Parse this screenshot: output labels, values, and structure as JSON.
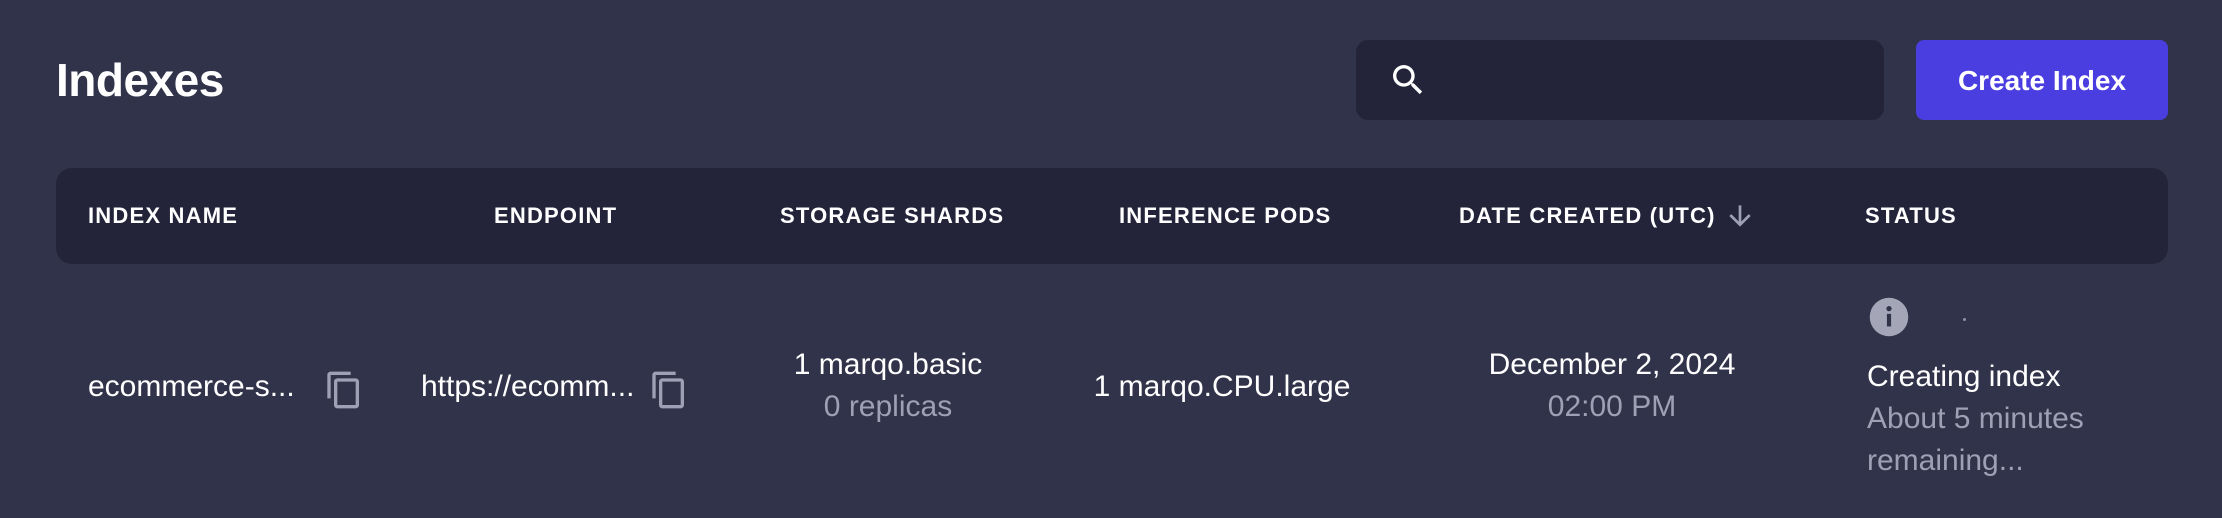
{
  "header": {
    "title": "Indexes",
    "create_button_label": "Create Index",
    "search": {
      "placeholder": "",
      "value": ""
    }
  },
  "table": {
    "columns": [
      "INDEX NAME",
      "ENDPOINT",
      "STORAGE SHARDS",
      "INFERENCE PODS",
      "DATE CREATED (UTC)",
      "STATUS"
    ],
    "sort": {
      "column": "DATE CREATED (UTC)",
      "direction": "descending"
    },
    "rows": [
      {
        "index_name": "ecommerce-s...",
        "endpoint": "https://ecomm...",
        "storage_shards": "1 marqo.basic",
        "replicas": "0 replicas",
        "inference_pods": "1 marqo.CPU.large",
        "date": "December 2, 2024",
        "time": "02:00 PM",
        "status": "Creating index",
        "status_detail_line1": "About 5 minutes",
        "status_detail_line2": "remaining..."
      }
    ]
  },
  "icons": {
    "search": "search-icon",
    "sort": "arrow-down-icon",
    "copy": "copy-icon",
    "info": "info-icon"
  },
  "colors": {
    "background": "#31334a",
    "panel": "#23243a",
    "accent": "#4b3ee0",
    "muted_text": "#9ea0b5"
  }
}
